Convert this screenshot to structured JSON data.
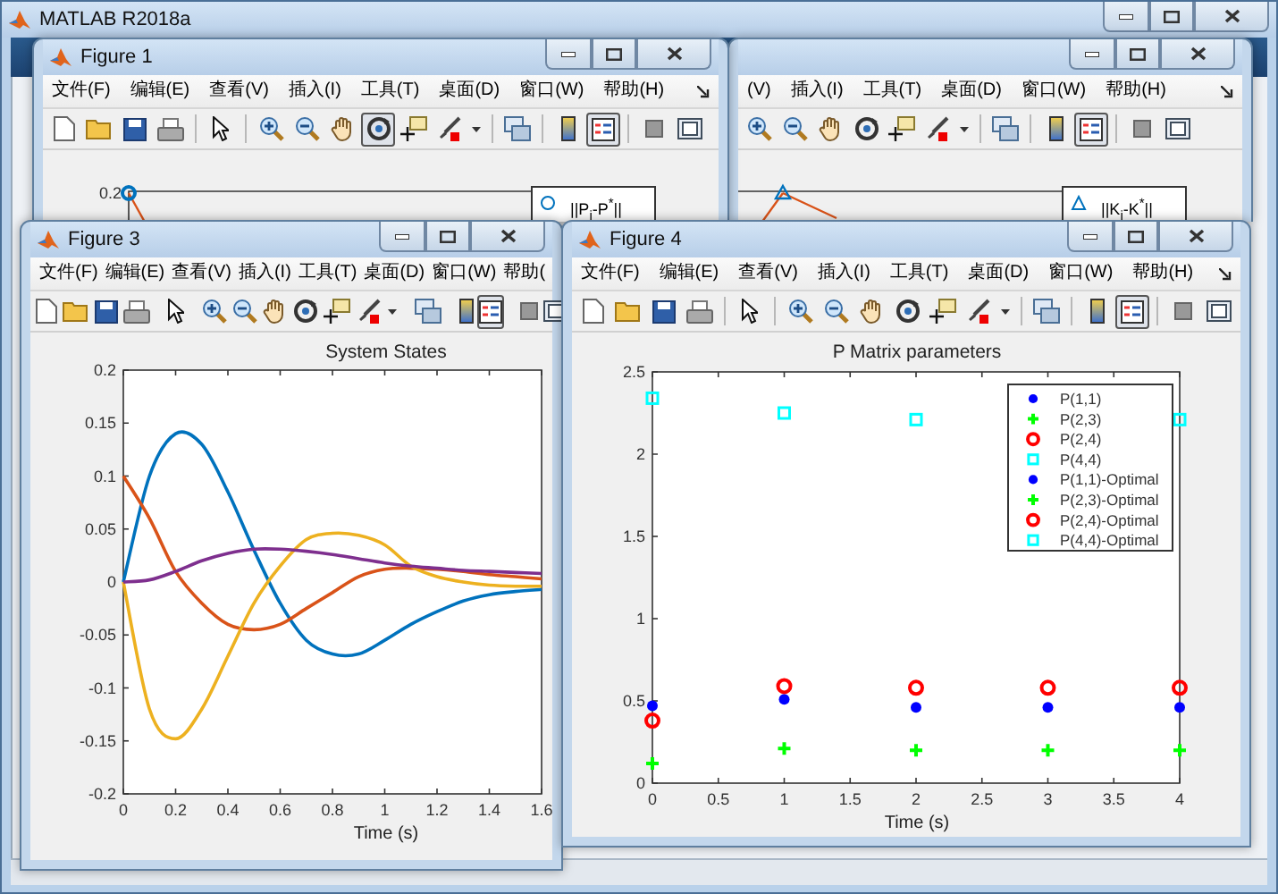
{
  "main_window": {
    "title": "MATLAB R2018a"
  },
  "figures": [
    {
      "title": "Figure 1",
      "menu": [
        "文件(F)",
        "编辑(E)",
        "查看(V)",
        "插入(I)",
        "工具(T)",
        "桌面(D)",
        "窗口(W)",
        "帮助(H)"
      ],
      "toolbar": [
        [
          {
            "kind": "new",
            "selected": false
          },
          {
            "kind": "open",
            "selected": false
          },
          {
            "kind": "save",
            "selected": false
          },
          {
            "kind": "print",
            "selected": false
          }
        ],
        [
          {
            "kind": "pointer",
            "selected": false
          }
        ],
        [
          {
            "kind": "zoom-in",
            "selected": false
          },
          {
            "kind": "zoom-out",
            "selected": false
          },
          {
            "kind": "pan",
            "selected": false
          },
          {
            "kind": "rotate",
            "selected": true
          },
          {
            "kind": "datatip",
            "selected": false
          },
          {
            "kind": "brush",
            "selected": false
          },
          {
            "kind": "brush-menu",
            "selected": false
          }
        ],
        [
          {
            "kind": "link",
            "selected": false
          }
        ],
        [
          {
            "kind": "colorbar",
            "selected": false
          },
          {
            "kind": "legend",
            "selected": true
          }
        ],
        [
          {
            "kind": "hide",
            "selected": false
          },
          {
            "kind": "show",
            "selected": false
          }
        ]
      ],
      "plot_fragment": {
        "ytick": "0.2",
        "kind": "circle",
        "legend": "||P$_{i}$-P$^{*}$||"
      }
    },
    {
      "menu": [
        "(V)",
        "插入(I)",
        "工具(T)",
        "桌面(D)",
        "窗口(W)",
        "帮助(H)"
      ],
      "toolbar": [
        [
          {
            "kind": "zoom-in",
            "selected": false
          },
          {
            "kind": "zoom-out",
            "selected": false
          },
          {
            "kind": "pan",
            "selected": false
          },
          {
            "kind": "rotate",
            "selected": false
          },
          {
            "kind": "datatip",
            "selected": false
          },
          {
            "kind": "brush",
            "selected": false
          },
          {
            "kind": "brush-menu",
            "selected": false
          }
        ],
        [
          {
            "kind": "link",
            "selected": false
          }
        ],
        [
          {
            "kind": "colorbar",
            "selected": false
          },
          {
            "kind": "legend",
            "selected": true
          }
        ],
        [
          {
            "kind": "hide",
            "selected": false
          },
          {
            "kind": "show",
            "selected": false
          }
        ]
      ],
      "plot_fragment": {
        "kind": "triangle",
        "legend": "||K$_{i}$-K$^{*}$||"
      }
    },
    {
      "title": "Figure 3",
      "menu": [
        "文件(F)",
        "编辑(E)",
        "查看(V)",
        "插入(I)",
        "工具(T)",
        "桌面(D)",
        "窗口(W)",
        "帮助("
      ],
      "toolbar": [
        [
          {
            "kind": "new",
            "selected": false
          },
          {
            "kind": "open",
            "selected": false
          },
          {
            "kind": "save",
            "selected": false
          },
          {
            "kind": "print",
            "selected": false
          }
        ],
        [
          {
            "kind": "pointer",
            "selected": false
          }
        ],
        [
          {
            "kind": "zoom-in",
            "selected": false
          },
          {
            "kind": "zoom-out",
            "selected": false
          },
          {
            "kind": "pan",
            "selected": false
          },
          {
            "kind": "rotate",
            "selected": false
          },
          {
            "kind": "datatip",
            "selected": false
          },
          {
            "kind": "brush",
            "selected": false
          },
          {
            "kind": "brush-menu",
            "selected": false
          }
        ],
        [
          {
            "kind": "link",
            "selected": false
          }
        ],
        [
          {
            "kind": "colorbar",
            "selected": false
          },
          {
            "kind": "legend",
            "selected": true
          }
        ],
        [
          {
            "kind": "hide",
            "selected": false
          },
          {
            "kind": "show",
            "selected": false
          }
        ]
      ],
      "chart_data": {
        "type": "line",
        "title": "System States",
        "xlabel": "Time (s)",
        "x": [
          0,
          0.1,
          0.2,
          0.3,
          0.4,
          0.5,
          0.6,
          0.7,
          0.8,
          0.9,
          1,
          1.1,
          1.2,
          1.3,
          1.4,
          1.5,
          1.6
        ],
        "series": [
          {
            "color": "#0072bd",
            "values": [
              0,
              0.1,
              0.14,
              0.13,
              0.085,
              0.03,
              -0.02,
              -0.055,
              -0.068,
              -0.068,
              -0.055,
              -0.04,
              -0.028,
              -0.018,
              -0.012,
              -0.009,
              -0.007
            ]
          },
          {
            "color": "#d95319",
            "values": [
              0.1,
              0.06,
              0.01,
              -0.02,
              -0.04,
              -0.045,
              -0.04,
              -0.025,
              -0.01,
              0.005,
              0.012,
              0.013,
              0.012,
              0.01,
              0.007,
              0.005,
              0.003
            ]
          },
          {
            "color": "#edb120",
            "values": [
              0,
              -0.12,
              -0.148,
              -0.12,
              -0.07,
              -0.02,
              0.015,
              0.04,
              0.046,
              0.044,
              0.035,
              0.015,
              0.005,
              0,
              -0.003,
              -0.004,
              -0.004
            ]
          },
          {
            "color": "#7e2f8e",
            "values": [
              0,
              0.002,
              0.01,
              0.02,
              0.027,
              0.031,
              0.031,
              0.029,
              0.026,
              0.022,
              0.018,
              0.015,
              0.013,
              0.011,
              0.01,
              0.009,
              0.008
            ]
          }
        ],
        "xlim": [
          0,
          1.6
        ],
        "ylim": [
          -0.2,
          0.2
        ],
        "xticks": [
          0,
          0.2,
          0.4,
          0.6,
          0.8,
          1,
          1.2,
          1.4,
          1.6
        ],
        "yticks": [
          -0.2,
          -0.15,
          -0.1,
          -0.05,
          0,
          0.05,
          0.1,
          0.15,
          0.2
        ]
      }
    },
    {
      "title": "Figure 4",
      "menu": [
        "文件(F)",
        "编辑(E)",
        "查看(V)",
        "插入(I)",
        "工具(T)",
        "桌面(D)",
        "窗口(W)",
        "帮助(H)"
      ],
      "toolbar": [
        [
          {
            "kind": "new",
            "selected": false
          },
          {
            "kind": "open",
            "selected": false
          },
          {
            "kind": "save",
            "selected": false
          },
          {
            "kind": "print",
            "selected": false
          }
        ],
        [
          {
            "kind": "pointer",
            "selected": false
          }
        ],
        [
          {
            "kind": "zoom-in",
            "selected": false
          },
          {
            "kind": "zoom-out",
            "selected": false
          },
          {
            "kind": "pan",
            "selected": false
          },
          {
            "kind": "rotate",
            "selected": false
          },
          {
            "kind": "datatip",
            "selected": false
          },
          {
            "kind": "brush",
            "selected": false
          },
          {
            "kind": "brush-menu",
            "selected": false
          }
        ],
        [
          {
            "kind": "link",
            "selected": false
          }
        ],
        [
          {
            "kind": "colorbar",
            "selected": false
          },
          {
            "kind": "legend",
            "selected": true
          }
        ],
        [
          {
            "kind": "hide",
            "selected": false
          },
          {
            "kind": "show",
            "selected": false
          }
        ]
      ],
      "chart_data": {
        "type": "scatter",
        "title": "P Matrix parameters",
        "xlabel": "Time (s)",
        "x": [
          0,
          1,
          2,
          3,
          4
        ],
        "series": [
          {
            "name": "P(1,1)",
            "color": "#0000ff",
            "marker": "dot",
            "values": [
              0.47,
              0.51,
              0.46,
              0.46,
              null
            ]
          },
          {
            "name": "P(2,3)",
            "color": "#00ff00",
            "marker": "plus",
            "values": [
              0.12,
              0.21,
              0.2,
              0.2,
              null
            ]
          },
          {
            "name": "P(2,4)",
            "color": "#ff0000",
            "marker": "circle",
            "values": [
              0.38,
              0.59,
              0.58,
              0.58,
              null
            ]
          },
          {
            "name": "P(4,4)",
            "color": "#00ffff",
            "marker": "square",
            "values": [
              2.34,
              2.25,
              2.21,
              null,
              null
            ]
          },
          {
            "name": "P(1,1)-Optimal",
            "color": "#0000ff",
            "marker": "dot",
            "values": [
              null,
              null,
              null,
              null,
              0.46
            ]
          },
          {
            "name": "P(2,3)-Optimal",
            "color": "#00ff00",
            "marker": "plus",
            "values": [
              null,
              null,
              null,
              null,
              0.2
            ]
          },
          {
            "name": "P(2,4)-Optimal",
            "color": "#ff0000",
            "marker": "circle",
            "values": [
              null,
              null,
              null,
              null,
              0.58
            ]
          },
          {
            "name": "P(4,4)-Optimal",
            "color": "#00ffff",
            "marker": "square",
            "values": [
              null,
              null,
              null,
              null,
              2.21
            ]
          }
        ],
        "legend": "top right",
        "xlim": [
          0,
          4
        ],
        "ylim": [
          0,
          2.5
        ],
        "xticks": [
          0,
          0.5,
          1,
          1.5,
          2,
          2.5,
          3,
          3.5,
          4
        ],
        "yticks": [
          0,
          0.5,
          1,
          1.5,
          2,
          2.5
        ]
      }
    }
  ]
}
